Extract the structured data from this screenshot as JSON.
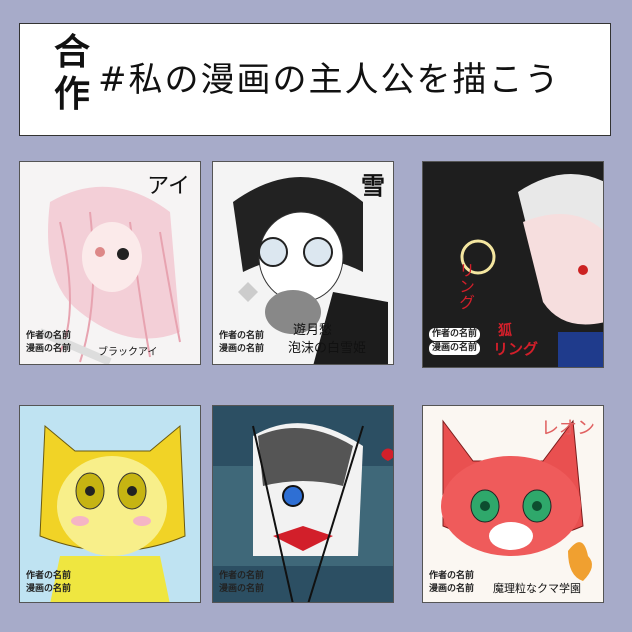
{
  "header": {
    "prefix": "合作",
    "title": "#私の漫画の主人公を描こう"
  },
  "panels": [
    {
      "label": "アイ",
      "author_label": "作者の名前",
      "manga_label": "漫画の名前",
      "author_value": "",
      "manga_value": "ブラックアイ"
    },
    {
      "label": "雪",
      "author_label": "作者の名前",
      "manga_label": "漫画の名前",
      "author_value": "遊月愁",
      "manga_value": "泡沫の白雪姫"
    },
    {
      "label": "リング",
      "author_label": "作者の名前",
      "manga_label": "漫画の名前",
      "author_value": "狐",
      "manga_value": "リング"
    },
    {
      "label": "",
      "author_label": "作者の名前",
      "manga_label": "漫画の名前",
      "author_value": "",
      "manga_value": ""
    },
    {
      "label": "",
      "author_label": "作者の名前",
      "manga_label": "漫画の名前",
      "author_value": "",
      "manga_value": ""
    },
    {
      "label": "レオン",
      "author_label": "作者の名前",
      "manga_label": "漫画の名前",
      "author_value": "",
      "manga_value": "魔理粒なクマ学園"
    }
  ],
  "colors": {
    "background": "#a7abc9",
    "ring_red": "#d21f2a",
    "highlight_blue": "#2a64d8"
  }
}
